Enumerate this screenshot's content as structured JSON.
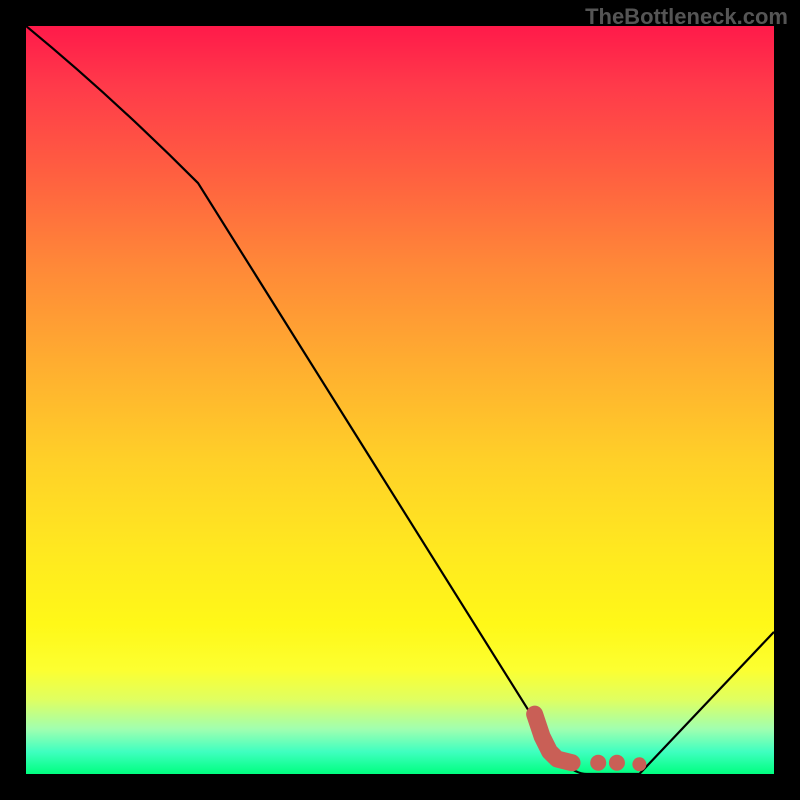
{
  "watermark": "TheBottleneck.com",
  "chart_data": {
    "type": "line",
    "title": "",
    "xlabel": "",
    "ylabel": "",
    "xlim": [
      0,
      100
    ],
    "ylim": [
      0,
      100
    ],
    "series": [
      {
        "name": "bottleneck-curve",
        "x": [
          0,
          23,
          70,
          75,
          82,
          100
        ],
        "y": [
          100,
          79,
          4,
          0,
          0,
          19
        ]
      }
    ],
    "markers": {
      "name": "highlight-region",
      "color": "#c95f56",
      "points": [
        {
          "x": 68,
          "y": 8
        },
        {
          "x": 69,
          "y": 5
        },
        {
          "x": 70,
          "y": 3
        },
        {
          "x": 71,
          "y": 2
        },
        {
          "x": 73,
          "y": 1.5
        },
        {
          "x": 76.5,
          "y": 1.5
        },
        {
          "x": 79,
          "y": 1.5
        },
        {
          "x": 82,
          "y": 1.3
        }
      ]
    }
  }
}
